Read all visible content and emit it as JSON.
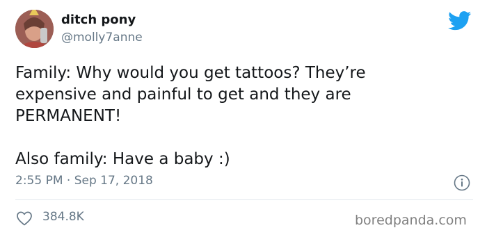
{
  "user": {
    "display_name": "ditch pony",
    "handle": "@molly7anne",
    "avatar_icon": "user-avatar-photo"
  },
  "brand": {
    "logo_icon": "twitter-bird-icon",
    "color": "#1da1f2"
  },
  "tweet": {
    "text": "Family: Why would you get tattoos? They’re\nexpensive and painful to get and they are\nPERMANENT!\n\nAlso family: Have a baby :)",
    "timestamp": "2:55 PM · Sep 17, 2018"
  },
  "stats": {
    "likes": "384.8K",
    "like_icon": "heart-icon",
    "info_icon": "info-icon"
  },
  "watermark": {
    "text": "boredpanda.com"
  }
}
